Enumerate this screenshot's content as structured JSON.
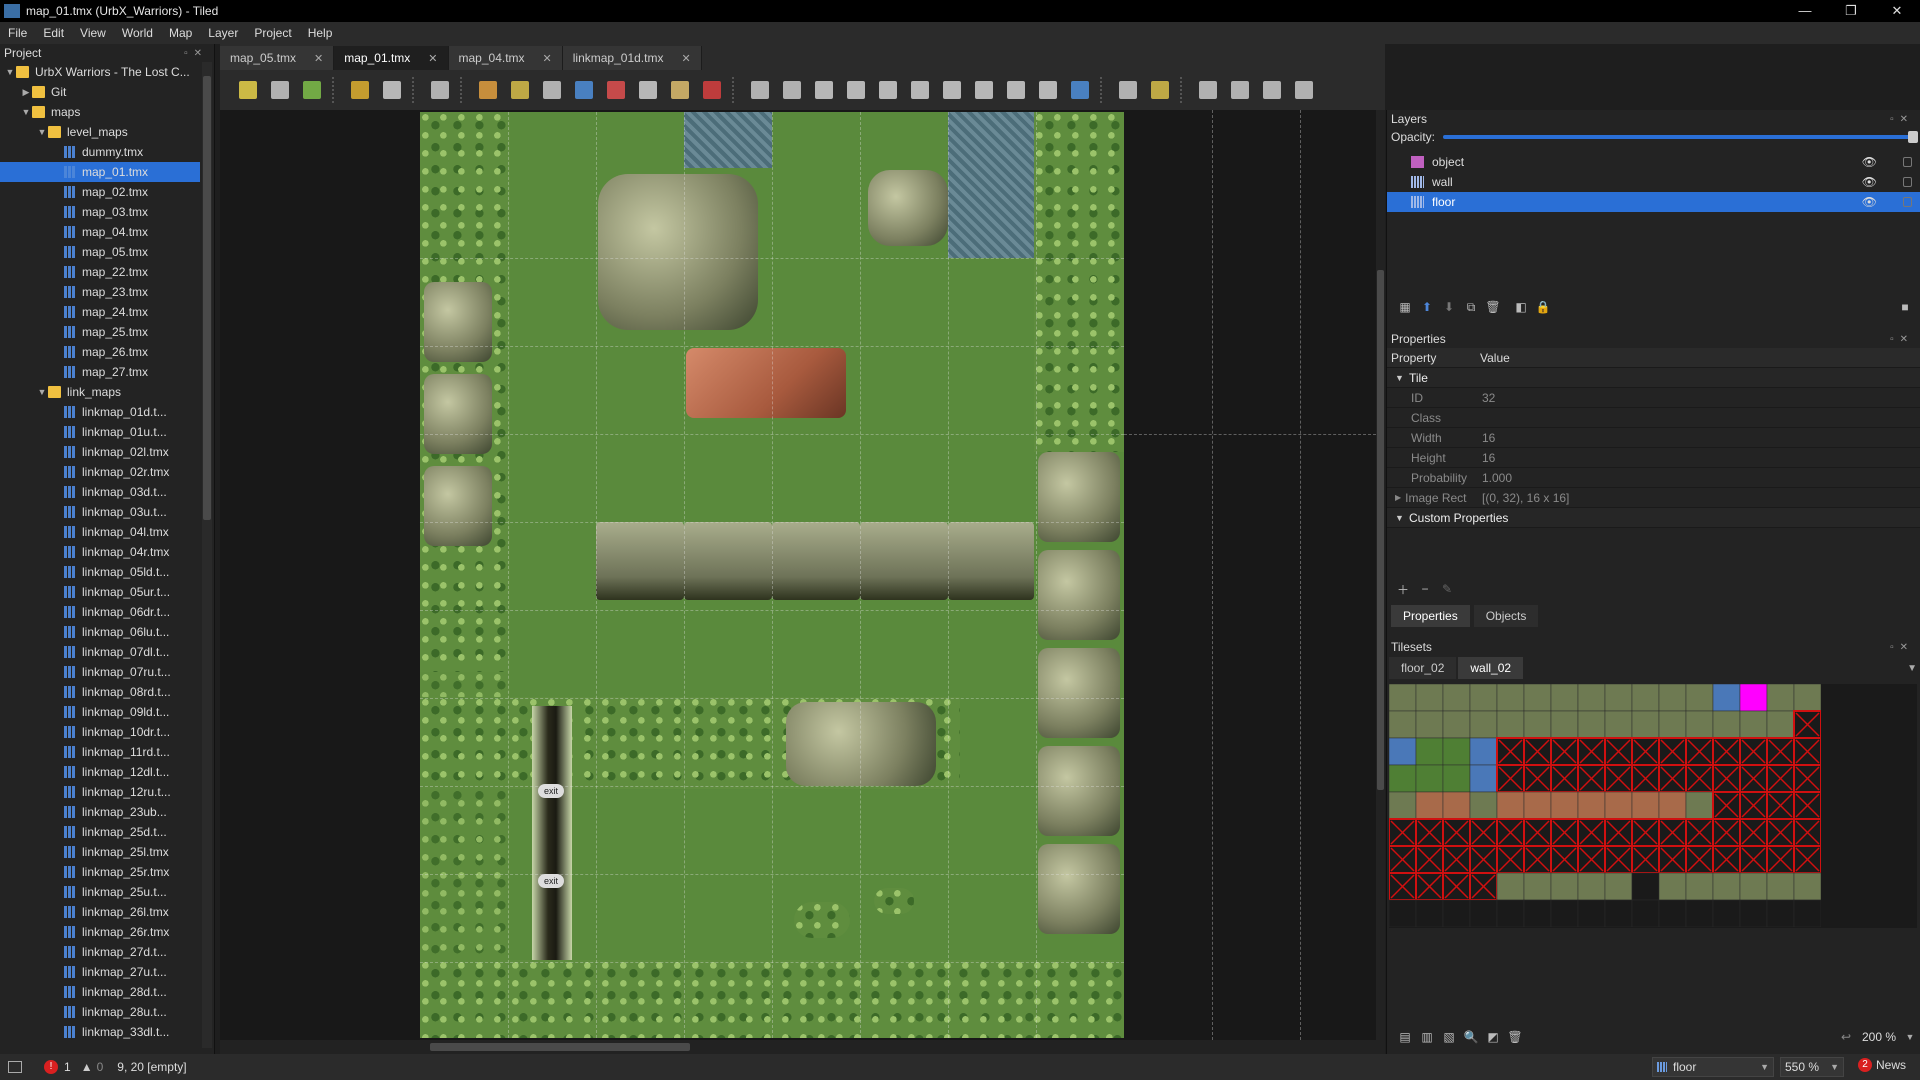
{
  "window": {
    "title": "map_01.tmx (UrbX_Warriors) - Tiled",
    "minimize": "—",
    "maximize": "❐",
    "close": "✕"
  },
  "menu": [
    "File",
    "Edit",
    "View",
    "World",
    "Map",
    "Layer",
    "Project",
    "Help"
  ],
  "project": {
    "title": "Project",
    "items": [
      {
        "label": "UrbX Warriors - The Lost C...",
        "type": "folder",
        "depth": 0,
        "expanded": true
      },
      {
        "label": "Git",
        "type": "folder",
        "depth": 1,
        "expanded": false
      },
      {
        "label": "maps",
        "type": "folder",
        "depth": 1,
        "expanded": true
      },
      {
        "label": "level_maps",
        "type": "folder",
        "depth": 2,
        "expanded": true
      },
      {
        "label": "dummy.tmx",
        "type": "file",
        "depth": 3
      },
      {
        "label": "map_01.tmx",
        "type": "file",
        "depth": 3,
        "selected": true
      },
      {
        "label": "map_02.tmx",
        "type": "file",
        "depth": 3
      },
      {
        "label": "map_03.tmx",
        "type": "file",
        "depth": 3
      },
      {
        "label": "map_04.tmx",
        "type": "file",
        "depth": 3
      },
      {
        "label": "map_05.tmx",
        "type": "file",
        "depth": 3
      },
      {
        "label": "map_22.tmx",
        "type": "file",
        "depth": 3
      },
      {
        "label": "map_23.tmx",
        "type": "file",
        "depth": 3
      },
      {
        "label": "map_24.tmx",
        "type": "file",
        "depth": 3
      },
      {
        "label": "map_25.tmx",
        "type": "file",
        "depth": 3
      },
      {
        "label": "map_26.tmx",
        "type": "file",
        "depth": 3
      },
      {
        "label": "map_27.tmx",
        "type": "file",
        "depth": 3
      },
      {
        "label": "link_maps",
        "type": "folder",
        "depth": 2,
        "expanded": true
      },
      {
        "label": "linkmap_01d.t...",
        "type": "file",
        "depth": 3
      },
      {
        "label": "linkmap_01u.t...",
        "type": "file",
        "depth": 3
      },
      {
        "label": "linkmap_02l.tmx",
        "type": "file",
        "depth": 3
      },
      {
        "label": "linkmap_02r.tmx",
        "type": "file",
        "depth": 3
      },
      {
        "label": "linkmap_03d.t...",
        "type": "file",
        "depth": 3
      },
      {
        "label": "linkmap_03u.t...",
        "type": "file",
        "depth": 3
      },
      {
        "label": "linkmap_04l.tmx",
        "type": "file",
        "depth": 3
      },
      {
        "label": "linkmap_04r.tmx",
        "type": "file",
        "depth": 3
      },
      {
        "label": "linkmap_05ld.t...",
        "type": "file",
        "depth": 3
      },
      {
        "label": "linkmap_05ur.t...",
        "type": "file",
        "depth": 3
      },
      {
        "label": "linkmap_06dr.t...",
        "type": "file",
        "depth": 3
      },
      {
        "label": "linkmap_06lu.t...",
        "type": "file",
        "depth": 3
      },
      {
        "label": "linkmap_07dl.t...",
        "type": "file",
        "depth": 3
      },
      {
        "label": "linkmap_07ru.t...",
        "type": "file",
        "depth": 3
      },
      {
        "label": "linkmap_08rd.t...",
        "type": "file",
        "depth": 3
      },
      {
        "label": "linkmap_09ld.t...",
        "type": "file",
        "depth": 3
      },
      {
        "label": "linkmap_10dr.t...",
        "type": "file",
        "depth": 3
      },
      {
        "label": "linkmap_11rd.t...",
        "type": "file",
        "depth": 3
      },
      {
        "label": "linkmap_12dl.t...",
        "type": "file",
        "depth": 3
      },
      {
        "label": "linkmap_12ru.t...",
        "type": "file",
        "depth": 3
      },
      {
        "label": "linkmap_23ub...",
        "type": "file",
        "depth": 3
      },
      {
        "label": "linkmap_25d.t...",
        "type": "file",
        "depth": 3
      },
      {
        "label": "linkmap_25l.tmx",
        "type": "file",
        "depth": 3
      },
      {
        "label": "linkmap_25r.tmx",
        "type": "file",
        "depth": 3
      },
      {
        "label": "linkmap_25u.t...",
        "type": "file",
        "depth": 3
      },
      {
        "label": "linkmap_26l.tmx",
        "type": "file",
        "depth": 3
      },
      {
        "label": "linkmap_26r.tmx",
        "type": "file",
        "depth": 3
      },
      {
        "label": "linkmap_27d.t...",
        "type": "file",
        "depth": 3
      },
      {
        "label": "linkmap_27u.t...",
        "type": "file",
        "depth": 3
      },
      {
        "label": "linkmap_28d.t...",
        "type": "file",
        "depth": 3
      },
      {
        "label": "linkmap_28u.t...",
        "type": "file",
        "depth": 3
      },
      {
        "label": "linkmap_33dl.t...",
        "type": "file",
        "depth": 3
      }
    ]
  },
  "tabs": [
    {
      "label": "map_05.tmx",
      "active": false
    },
    {
      "label": "map_01.tmx",
      "active": true
    },
    {
      "label": "map_04.tmx",
      "active": false
    },
    {
      "label": "linkmap_01d.tmx",
      "active": false
    }
  ],
  "toolbar": {
    "icons": [
      "new-map-icon",
      "open-icon",
      "save-icon",
      "undo-icon",
      "redo-icon",
      "commands-icon",
      "stamp-brush-icon",
      "terrain-brush-icon",
      "bucket-fill-icon",
      "shape-fill-icon",
      "eraser-icon",
      "rect-select-icon",
      "magic-wand-icon",
      "select-same-tile-icon",
      "select-objects-icon",
      "edit-polygons-icon",
      "insert-rectangle-icon",
      "insert-point-icon",
      "insert-ellipse-icon",
      "insert-polygon-icon",
      "insert-tile-icon",
      "insert-template-icon",
      "insert-text-icon",
      "world-tool-icon",
      "offset-map-icon",
      "random-mode-icon",
      "wang-fill-icon",
      "flip-horizontal-icon",
      "flip-vertical-icon",
      "rotate-left-icon",
      "rotate-right-icon"
    ]
  },
  "map_objects": [
    {
      "label": "exit"
    },
    {
      "label": "exit"
    }
  ],
  "layers": {
    "title": "Layers",
    "opacity_label": "Opacity:",
    "opacity": 1.0,
    "items": [
      {
        "label": "object",
        "kind": "object",
        "selected": false
      },
      {
        "label": "wall",
        "kind": "tile",
        "selected": false
      },
      {
        "label": "floor",
        "kind": "tile",
        "selected": true
      }
    ]
  },
  "properties": {
    "title": "Properties",
    "col_property": "Property",
    "col_value": "Value",
    "group_tile": "Tile",
    "rows": [
      {
        "k": "ID",
        "v": "32"
      },
      {
        "k": "Class",
        "v": ""
      },
      {
        "k": "Width",
        "v": "16"
      },
      {
        "k": "Height",
        "v": "16"
      },
      {
        "k": "Probability",
        "v": "1.000"
      },
      {
        "k": "Image Rect",
        "v": "[(0, 32), 16 x 16]"
      }
    ],
    "group_custom": "Custom Properties",
    "tab_properties": "Properties",
    "tab_objects": "Objects"
  },
  "tilesets": {
    "title": "Tilesets",
    "tabs": [
      "floor_02",
      "wall_02"
    ],
    "active_tab": "wall_02",
    "zoom": "200 %"
  },
  "status": {
    "errors": "1",
    "warnings": "0",
    "coords": "9, 20 [empty]",
    "layer_select": "floor",
    "zoom": "550 %",
    "news_count": "2",
    "news_label": "News"
  },
  "colors": {
    "selection": "#2a6fd6",
    "magenta_tile": "#ff00ff",
    "invalid_tile": "#d01010"
  }
}
